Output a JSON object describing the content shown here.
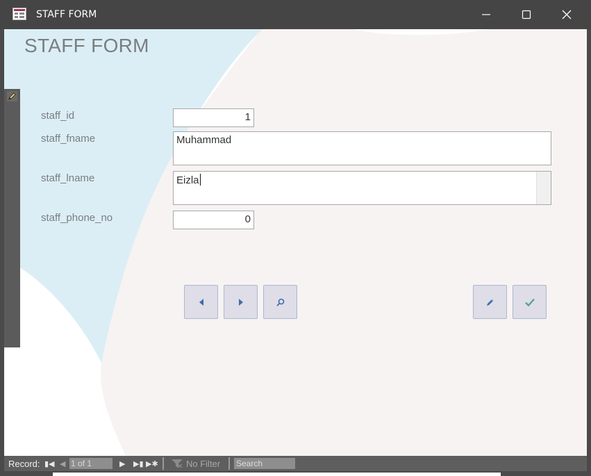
{
  "window": {
    "title": "STAFF FORM",
    "icon": "access-form-icon",
    "controls": [
      "minimize-icon",
      "maximize-icon",
      "close-icon"
    ]
  },
  "form": {
    "heading": "STAFF FORM",
    "fields": [
      {
        "label": "staff_id",
        "value": "1"
      },
      {
        "label": "staff_fname",
        "value": "Muhammad"
      },
      {
        "label": "staff_lname",
        "value": "Eizla"
      },
      {
        "label": "staff_phone_no",
        "value": "0"
      }
    ],
    "buttons": {
      "previous": "previous-record-icon",
      "next": "next-record-icon",
      "find": "search-icon",
      "edit": "pencil-icon",
      "save": "checkmark-icon"
    }
  },
  "statusbar": {
    "record_label": "Record:",
    "position": "1 of 1",
    "filter": "No Filter",
    "search_placeholder": "Search"
  },
  "colors": {
    "accent_blue": "#dbeef5",
    "background_beige": "#f7f3f2",
    "button_bg": "#dedde8",
    "icon_blue": "#3f6ea7",
    "check_green": "#5aa58a"
  }
}
